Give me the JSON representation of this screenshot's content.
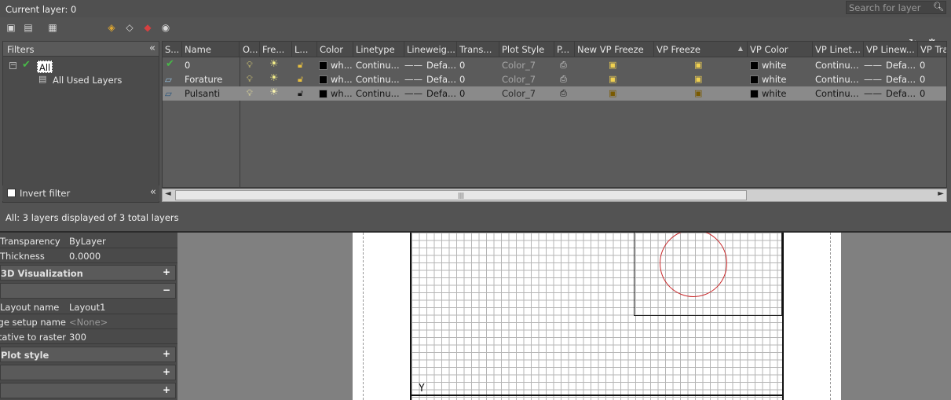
{
  "palette": {
    "title": "Current layer: 0",
    "search_placeholder": "Search for layer",
    "status": "All: 3 layers displayed of 3 total layers"
  },
  "filters": {
    "header": "Filters",
    "tree_all": "All",
    "tree_used": "All Used Layers",
    "invert_label": "Invert filter"
  },
  "columns": [
    "S...",
    "Name",
    "O...",
    "Fre...",
    "L...",
    "Color",
    "Linetype",
    "Lineweig...",
    "Trans...",
    "Plot Style",
    "P...",
    "New VP Freeze",
    "VP Freeze",
    "VP Color",
    "VP Linet...",
    "VP Linew...",
    "VP Tra"
  ],
  "layers": [
    {
      "name": "0",
      "color": "wh...",
      "linetype": "Continu...",
      "lineweight": "Defa...",
      "transparency": "0",
      "plot_style": "Color_7",
      "vp_color": "white",
      "vp_linetype": "Continu...",
      "vp_lineweight": "Defa...",
      "vp_transparency": "0"
    },
    {
      "name": "Forature",
      "color": "wh...",
      "linetype": "Continu...",
      "lineweight": "Defa...",
      "transparency": "0",
      "plot_style": "Color_7",
      "vp_color": "white",
      "vp_linetype": "Continu...",
      "vp_lineweight": "Defa...",
      "vp_transparency": "0"
    },
    {
      "name": "Pulsanti",
      "color": "wh...",
      "linetype": "Continu...",
      "lineweight": "Defa...",
      "transparency": "0",
      "plot_style": "Color_7",
      "vp_color": "white",
      "vp_linetype": "Continu...",
      "vp_lineweight": "Defa...",
      "vp_transparency": "0"
    }
  ],
  "properties": {
    "transparency_label": "Transparency",
    "transparency_value": "ByLayer",
    "thickness_label": "Thickness",
    "thickness_value": "0.0000",
    "visualization_label": "3D Visualization",
    "layout_name_label": "Layout name",
    "layout_name_value": "Layout1",
    "page_setup_label": "Page setup name",
    "page_setup_value": "<None>",
    "raster_label": "Annotative to raster",
    "raster_value": "300",
    "style_label": "Plot style",
    "plus": "+",
    "minus": "−"
  },
  "drawing": {
    "ucs_label": "Y"
  },
  "colors": {
    "selected_row": "#8a8a8a",
    "circle": "#c8282a",
    "current_check": "#48b848"
  }
}
